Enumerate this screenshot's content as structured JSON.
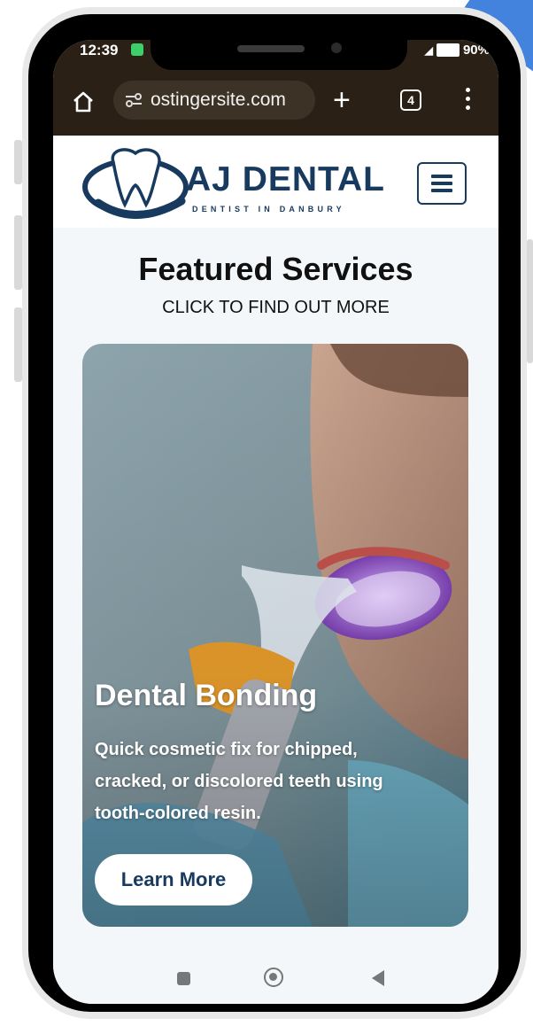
{
  "status": {
    "time": "12:39",
    "battery": "90%"
  },
  "browser": {
    "url": "ostingersite.com",
    "tab_count": "4"
  },
  "site": {
    "brand_name": "AJ DENTAL",
    "brand_tagline": "DENTIST IN DANBURY"
  },
  "section": {
    "title": "Featured Services",
    "subtitle": "CLICK TO FIND OUT MORE"
  },
  "card": {
    "title": "Dental Bonding",
    "description": "Quick cosmetic fix for chipped, cracked, or discolored teeth using tooth-colored resin.",
    "button_label": "Learn More"
  },
  "colors": {
    "brand_navy": "#173a5e",
    "browser_bar": "#2a2016",
    "page_bg": "#f4f7f9"
  }
}
